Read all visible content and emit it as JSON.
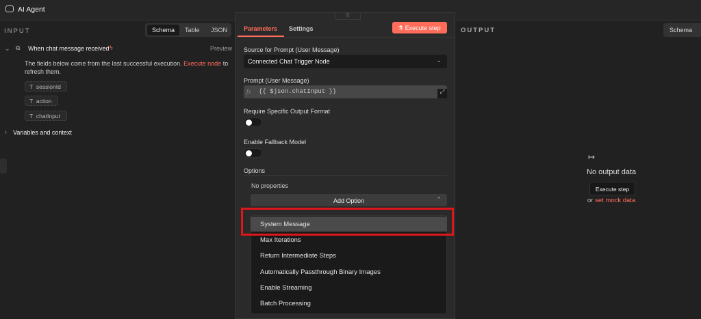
{
  "header": {
    "title": "AI Agent"
  },
  "input": {
    "title": "INPUT",
    "tabs": [
      "Schema",
      "Table",
      "JSON"
    ],
    "node": "When chat message received",
    "preview": "Preview",
    "notice": "The fields below come from the last successful execution.",
    "notice_link": "Execute node",
    "notice_end": "to refresh them.",
    "fields": [
      "sessionId",
      "action",
      "chatInput"
    ],
    "variables": "Variables and context"
  },
  "params": {
    "tabs": [
      "Parameters",
      "Settings"
    ],
    "execute": "Execute step",
    "source_label": "Source for Prompt (User Message)",
    "source_value": "Connected Chat Trigger Node",
    "prompt_label": "Prompt (User Message)",
    "prompt_value": "{{ $json.chatInput }}",
    "fx": "fx",
    "output_format": "Require Specific Output Format",
    "fallback": "Enable Fallback Model",
    "options": "Options",
    "no_props": "No properties",
    "add_option": "Add Option",
    "dropdown": [
      "System Message",
      "Max Iterations",
      "Return Intermediate Steps",
      "Automatically Passthrough Binary Images",
      "Enable Streaming",
      "Batch Processing"
    ]
  },
  "output": {
    "title": "OUTPUT",
    "schema": "Schema",
    "empty": "No output data",
    "execute": "Execute step",
    "or": "or",
    "mock": "set mock data"
  },
  "colors": {
    "accent": "#ff6d5a",
    "highlight": "#e0161b"
  }
}
